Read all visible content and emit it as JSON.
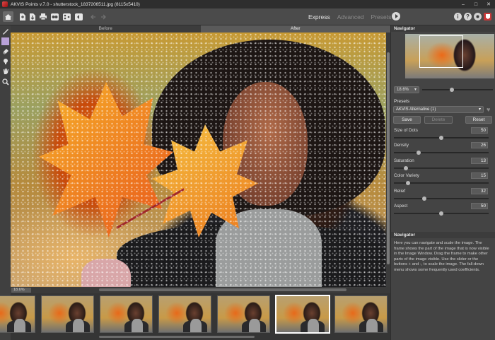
{
  "window": {
    "title": "AKVIS Points v.7.0 - shutterstock_1837206511.jpg (8115x5410)",
    "controls": {
      "minimize": "–",
      "maximize": "□",
      "close": "✕"
    }
  },
  "toolbar": {
    "icons": [
      "home-icon",
      "open-file-icon",
      "save-file-icon",
      "print-icon",
      "batch-icon",
      "share-icon",
      "before-after-icon",
      "undo-icon",
      "redo-icon"
    ],
    "modes": [
      "Express",
      "Advanced",
      "Presets"
    ],
    "active_mode": "Express",
    "right_icons": [
      "info-icon",
      "help-icon",
      "settings-icon",
      "plugin-icon"
    ]
  },
  "tools": [
    "brush-icon",
    "selection-icon",
    "eraser-icon",
    "stamp-icon",
    "hand-icon",
    "zoom-icon"
  ],
  "view_tabs": [
    "Before",
    "After"
  ],
  "active_view": "After",
  "status": {
    "zoom": "18.6%"
  },
  "filmstrip": {
    "count": 7,
    "selected": 5
  },
  "navigator": {
    "title": "Navigator",
    "zoom_value": "18.6%",
    "zoom_level": 0.42
  },
  "presets": {
    "title": "Presets",
    "selected": "AKVIS Alternative (1)",
    "save_label": "Save",
    "delete_label": "Delete",
    "reset_label": "Reset"
  },
  "parameters": [
    {
      "name": "Size of Dots",
      "value": "50",
      "level": 0.5
    },
    {
      "name": "Density",
      "value": "26",
      "level": 0.26
    },
    {
      "name": "Saturation",
      "value": "13",
      "level": 0.13
    },
    {
      "name": "Color Variety",
      "value": "15",
      "level": 0.15
    },
    {
      "name": "Relief",
      "value": "32",
      "level": 0.32
    },
    {
      "name": "Aspect",
      "value": "50",
      "level": 0.5
    }
  ],
  "help": {
    "title": "Navigator",
    "text": "Here you can navigate and scale the image. The frame shows the part of the image that is now visible in the Image Window. Drag the frame to make other parts of the image visible. Use the slider or the buttons + and -, to scale the image. The fall-down menu shows some frequently used coefficients."
  }
}
